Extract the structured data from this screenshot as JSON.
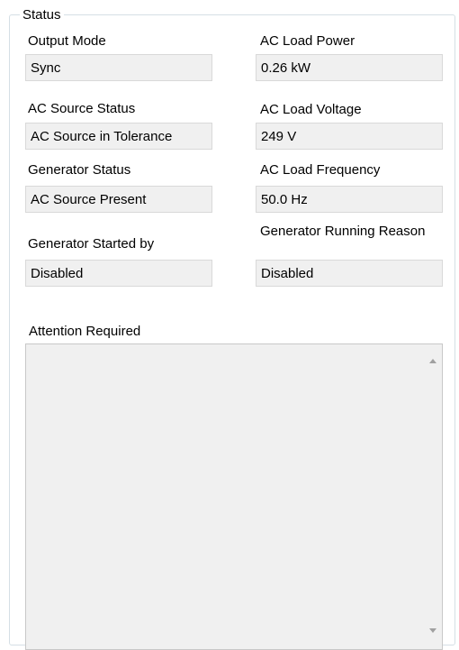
{
  "status_group": {
    "title": "Status",
    "output_mode": {
      "label": "Output Mode",
      "value": "Sync"
    },
    "ac_load_power": {
      "label": "AC Load Power",
      "value": "0.26 kW"
    },
    "ac_source_status": {
      "label": "AC Source Status",
      "value": "AC Source in Tolerance"
    },
    "ac_load_voltage": {
      "label": "AC Load Voltage",
      "value": "249 V"
    },
    "generator_status": {
      "label": "Generator Status",
      "value": "AC Source Present"
    },
    "ac_load_frequency": {
      "label": "AC Load Frequency",
      "value": "50.0 Hz"
    },
    "generator_started_by": {
      "label": "Generator Started by",
      "value": "Disabled"
    },
    "generator_running_reason": {
      "label": "Generator Running Reason",
      "value": "Disabled"
    },
    "attention_required": {
      "label": "Attention Required",
      "value": ""
    }
  },
  "icons": {
    "scroll_up": "chevron-up-icon",
    "scroll_down": "chevron-down-icon"
  },
  "colors": {
    "field_background": "#f0f0f0",
    "field_border": "#d9d9d9",
    "group_border": "#d5dfe5"
  }
}
